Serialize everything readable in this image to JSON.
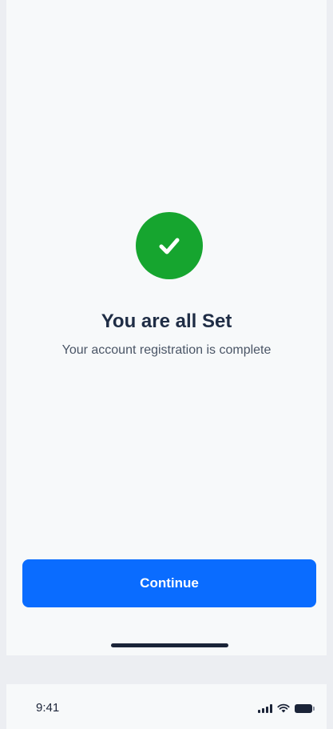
{
  "success": {
    "icon": "check-circle-icon",
    "title": "You are all Set",
    "subtitle": "Your account registration is complete"
  },
  "actions": {
    "continue_label": "Continue"
  },
  "status_bar": {
    "time": "9:41",
    "icons": [
      "cellular-signal-icon",
      "wifi-icon",
      "battery-icon"
    ]
  },
  "colors": {
    "success": "#16a52f",
    "primary": "#0a6cff",
    "heading": "#1f2d45",
    "body_text": "#4a5566",
    "background": "#f7f9fa"
  }
}
